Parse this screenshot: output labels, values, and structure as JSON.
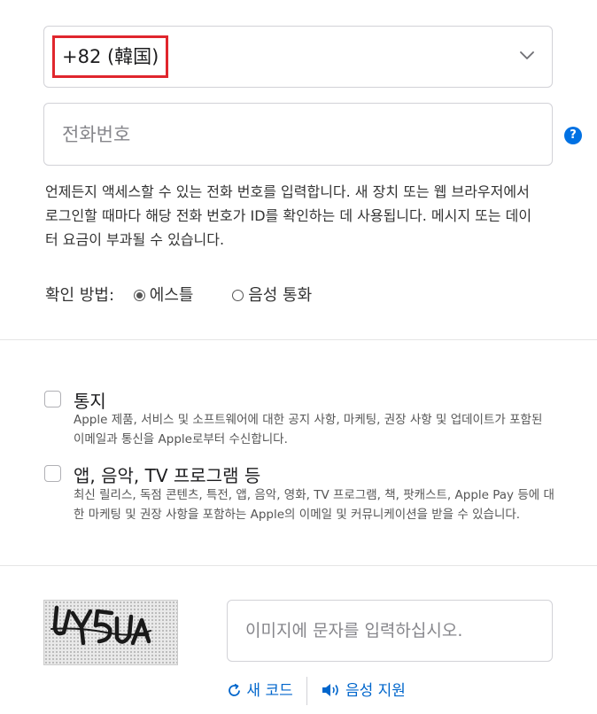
{
  "country_select": {
    "value": "+82 (韓国)",
    "icon": "chevron-down-icon"
  },
  "phone": {
    "placeholder": "전화번호",
    "help_icon": "question-icon",
    "help_glyph": "?"
  },
  "description": "언제든지 액세스할 수 있는 전화 번호를 입력합니다. 새 장치 또는 웹 브라우저에서 로그인할 때마다 해당 전화 번호가 ID를 확인하는 데 사용됩니다. 메시지 또는 데이터 요금이 부과될 수 있습니다.",
  "verification": {
    "label": "확인 방법:",
    "options": [
      {
        "label": "에스틀",
        "selected": true
      },
      {
        "label": "음성 통화",
        "selected": false
      }
    ]
  },
  "subscriptions": [
    {
      "title": "통지",
      "description": "Apple 제품, 서비스 및 소프트웨어에 대한 공지 사항, 마케팅, 권장 사항 및 업데이트가 포함된 이메일과 통신을 Apple로부터 수신합니다.",
      "checked": false
    },
    {
      "title": "앱, 음악, TV 프로그램 등",
      "description": "최신 릴리스, 독점 콘텐츠, 특전, 앱, 음악, 영화, TV 프로그램, 책, 팟캐스트, Apple Pay 등에 대한 마케팅 및 권장 사항을 포함하는 Apple의 이메일 및 커뮤니케이션을 받을 수 있습니다.",
      "checked": false
    }
  ],
  "captcha": {
    "text": "UY5UA",
    "placeholder": "이미지에 문자를 입력하십시오.",
    "new_code": "새 코드",
    "audio": "음성 지원",
    "new_code_icon": "refresh-icon",
    "audio_icon": "speaker-icon"
  },
  "colors": {
    "accent": "#0071e3",
    "highlight": "#e0262d",
    "link": "#0066cc"
  }
}
